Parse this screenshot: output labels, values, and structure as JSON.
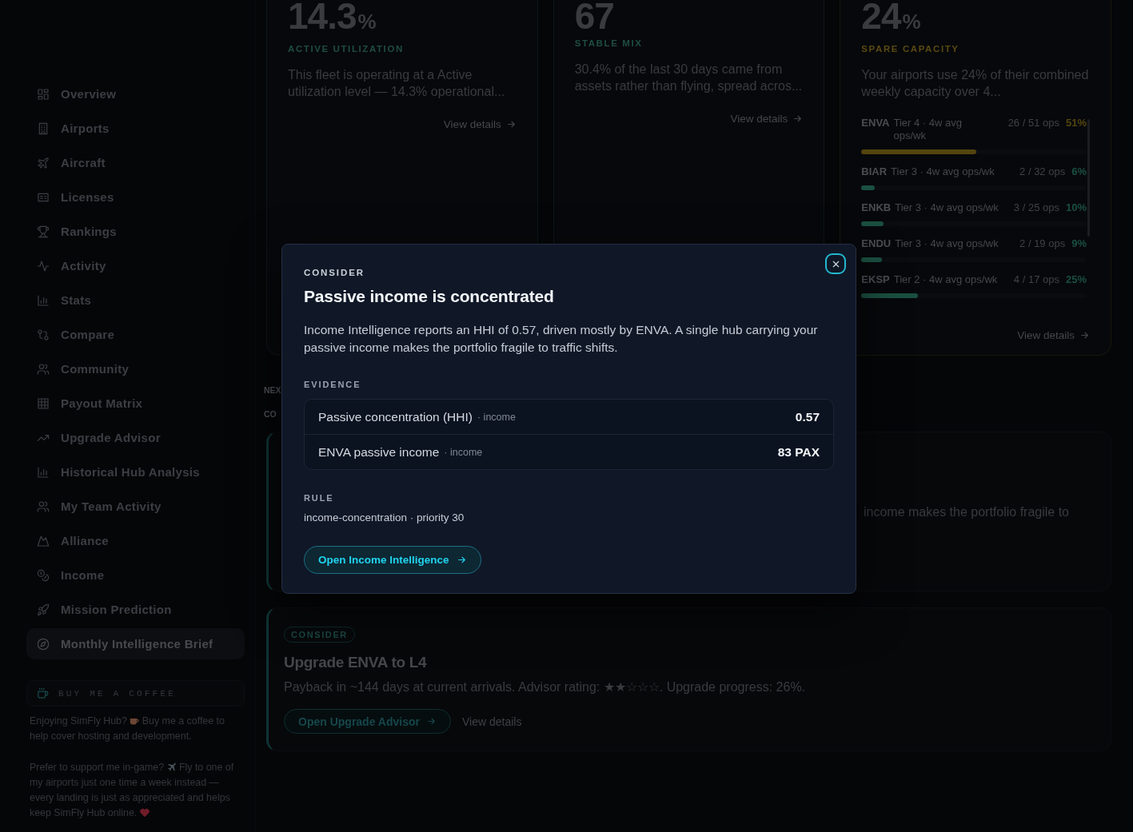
{
  "sidebar": {
    "items": [
      {
        "label": "Overview",
        "selected": false
      },
      {
        "label": "Airports",
        "selected": false
      },
      {
        "label": "Aircraft",
        "selected": false
      },
      {
        "label": "Licenses",
        "selected": false
      },
      {
        "label": "Rankings",
        "selected": false
      },
      {
        "label": "Activity",
        "selected": false
      },
      {
        "label": "Stats",
        "selected": false
      },
      {
        "label": "Compare",
        "selected": false
      },
      {
        "label": "Community",
        "selected": false
      },
      {
        "label": "Payout Matrix",
        "selected": false
      },
      {
        "label": "Upgrade Advisor",
        "selected": false
      },
      {
        "label": "Historical Hub Analysis",
        "selected": false
      },
      {
        "label": "My Team Activity",
        "selected": false
      },
      {
        "label": "Alliance",
        "selected": false
      },
      {
        "label": "Income",
        "selected": false
      },
      {
        "label": "Mission Prediction",
        "selected": false
      },
      {
        "label": "Monthly Intelligence Brief",
        "selected": true
      }
    ]
  },
  "support": {
    "button": "BUY ME A COFFEE",
    "notes": [
      {
        "parts": [
          {
            "kind": "text",
            "text": "Enjoying SimFly Hub?"
          },
          {
            "kind": "coffee"
          },
          {
            "kind": "text",
            "text": "Buy me a coffee to help cover hosting and development."
          }
        ]
      },
      {
        "parts": [
          {
            "kind": "text",
            "text": "Prefer to support me in-game?"
          },
          {
            "kind": "plane"
          },
          {
            "kind": "text",
            "text": "Fly to one of my airports just one time a week instead — every landing is just as appreciated and helps keep SimFly Hub online."
          },
          {
            "kind": "heart"
          }
        ]
      }
    ]
  },
  "metrics": [
    {
      "value": "14.3",
      "unit": "%",
      "label": "ACTIVE UTILIZATION",
      "color": "#1f4d44",
      "description": "This fleet is operating at a Active utilization level — 14.3% operational...",
      "link": "View details"
    },
    {
      "value": "67",
      "label": "STABLE MIX",
      "color": "#1f4d44",
      "description": "30.4% of the last 30 days came from assets rather than flying, spread acros...",
      "link": "View details"
    },
    {
      "value": "24",
      "unit": "%",
      "label": "SPARE CAPACITY",
      "color": "#5a4a12",
      "description": "Your airports use 24% of their combined weekly capacity over 4...",
      "rows": [
        {
          "code": "ENVA",
          "tier": "Tier 4 · 4w avg ops/wk",
          "ops": "26 / 51 ops",
          "percent": "51%",
          "level": 0.51,
          "color": "#54450f"
        },
        {
          "code": "BIAR",
          "tier": "Tier 3 · 4w avg ops/wk",
          "ops": "2 / 32 ops",
          "percent": "6%",
          "level": 0.06,
          "color": "#1a4f3f"
        },
        {
          "code": "ENKB",
          "tier": "Tier 3 · 4w avg ops/wk",
          "ops": "3 / 25 ops",
          "percent": "10%",
          "level": 0.1,
          "color": "#1a4f3f"
        },
        {
          "code": "ENDU",
          "tier": "Tier 3 · 4w avg ops/wk",
          "ops": "2 / 19 ops",
          "percent": "9%",
          "level": 0.09,
          "color": "#1a4f3f"
        },
        {
          "code": "EKSP",
          "tier": "Tier 2 · 4w avg ops/wk",
          "ops": "4 / 17 ops",
          "percent": "25%",
          "level": 0.25,
          "color": "#1a4f3f"
        }
      ],
      "link": "View details"
    }
  ],
  "section_heading": "NEX",
  "group_heading": "CO",
  "context_card": {
    "text": "income makes the portfolio fragile to"
  },
  "recommendation": {
    "badge": "CONSIDER",
    "title": "Upgrade ENVA to L4",
    "description": "Payback in ~144 days at current arrivals. Advisor rating: ★★☆☆☆. Upgrade progress: 26%.",
    "primary_button": "Open Upgrade Advisor",
    "secondary_link": "View details"
  },
  "modal": {
    "eyebrow": "CONSIDER",
    "title": "Passive income is concentrated",
    "body": "Income Intelligence reports an HHI of 0.57, driven mostly by ENVA. A single hub carrying your passive income makes the portfolio fragile to traffic shifts.",
    "evidence_heading": "EVIDENCE",
    "evidence": [
      {
        "label": "Passive concentration (HHI)",
        "source": "· income",
        "value": "0.57"
      },
      {
        "label": "ENVA passive income",
        "source": "· income",
        "value": "83 PAX"
      }
    ],
    "rule_heading": "RULE",
    "rule": "income-concentration · priority 30",
    "button": "Open Income Intelligence"
  }
}
